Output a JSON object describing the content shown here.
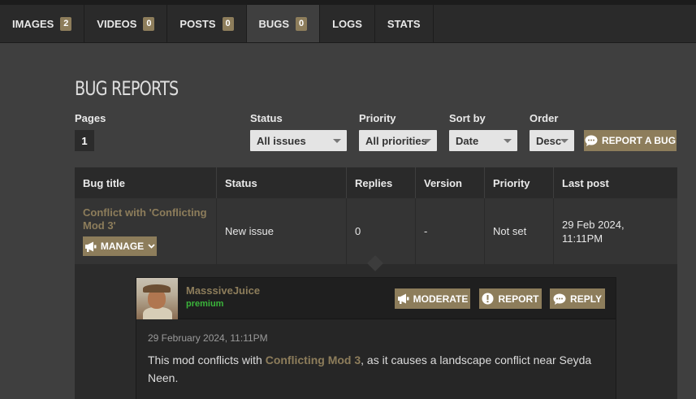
{
  "tabs": [
    {
      "label": "IMAGES",
      "count": "2"
    },
    {
      "label": "VIDEOS",
      "count": "0"
    },
    {
      "label": "POSTS",
      "count": "0"
    },
    {
      "label": "BUGS",
      "count": "0"
    },
    {
      "label": "LOGS"
    },
    {
      "label": "STATS"
    }
  ],
  "active_tab": "BUGS",
  "page_title": "BUG REPORTS",
  "filters": {
    "pages_label": "Pages",
    "page_current": "1",
    "status_label": "Status",
    "status_value": "All issues",
    "priority_label": "Priority",
    "priority_value": "All priorities",
    "sortby_label": "Sort by",
    "sortby_value": "Date",
    "order_label": "Order",
    "order_value": "Desc"
  },
  "report_bug_label": "REPORT A BUG",
  "table": {
    "headers": [
      "Bug title",
      "Status",
      "Replies",
      "Version",
      "Priority",
      "Last post"
    ],
    "rows": [
      {
        "title": "Conflict with 'Conflicting Mod 3'",
        "manage_label": "MANAGE",
        "status": "New issue",
        "replies": "0",
        "version": "-",
        "priority": "Not set",
        "last_post": "29 Feb 2024, 11:11PM"
      }
    ]
  },
  "comment": {
    "username": "MasssiveJuice",
    "role": "premium",
    "moderate_label": "MODERATE",
    "report_label": "REPORT",
    "reply_label": "REPLY",
    "timestamp": "29 February 2024, 11:11PM",
    "text_before": "This mod conflicts with ",
    "text_link": "Conflicting Mod 3",
    "text_after": ", as it causes a landscape conflict near Seyda Neen."
  },
  "colors": {
    "accent": "#8d7d5b",
    "status_new": "#dd8a2a",
    "premium": "#3bb53b"
  }
}
